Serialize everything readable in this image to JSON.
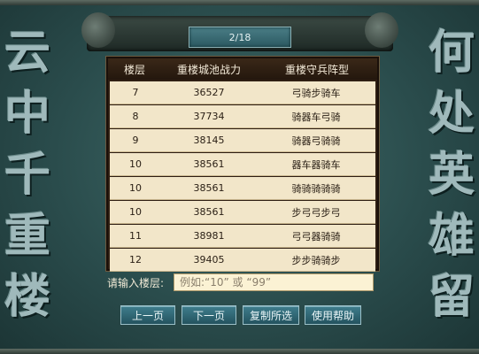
{
  "left_title": [
    "云",
    "中",
    "千",
    "重",
    "楼"
  ],
  "right_title": [
    "何",
    "处",
    "英",
    "雄",
    "留"
  ],
  "page_indicator": "2/18",
  "table": {
    "headers": [
      "楼层",
      "重楼城池战力",
      "重楼守兵阵型"
    ],
    "rows": [
      [
        "7",
        "36527",
        "弓骑步骑车"
      ],
      [
        "8",
        "37734",
        "骑器车弓骑"
      ],
      [
        "9",
        "38145",
        "骑器弓骑骑"
      ],
      [
        "10",
        "38561",
        "器车器骑车"
      ],
      [
        "10",
        "38561",
        "骑骑骑骑骑"
      ],
      [
        "10",
        "38561",
        "步弓弓步弓"
      ],
      [
        "11",
        "38981",
        "弓弓器骑骑"
      ],
      [
        "12",
        "39405",
        "步步骑骑步"
      ]
    ]
  },
  "input": {
    "label": "请输入楼层:",
    "placeholder": "例如:“10” 或 “99”"
  },
  "buttons": {
    "prev": "上一页",
    "next": "下一页",
    "copy": "复制所选",
    "help": "使用帮助"
  }
}
